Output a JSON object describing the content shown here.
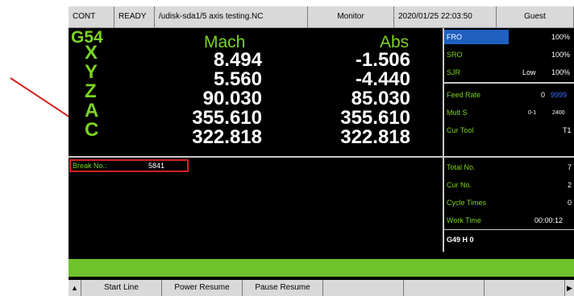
{
  "topbar": {
    "mode": "CONT",
    "state": "READY",
    "file": "/udisk-sda1/5 axis testing.NC",
    "view": "Monitor",
    "datetime": "2020/01/25 22:03:50",
    "user": "Guest"
  },
  "coords": {
    "wcs": "G54",
    "mach_title": "Mach",
    "abs_title": "Abs",
    "axes": [
      {
        "name": "X",
        "mach": "8.494",
        "abs": "-1.506"
      },
      {
        "name": "Y",
        "mach": "5.560",
        "abs": "-4.440"
      },
      {
        "name": "Z",
        "mach": "90.030",
        "abs": "85.030"
      },
      {
        "name": "A",
        "mach": "355.610",
        "abs": "355.610"
      },
      {
        "name": "C",
        "mach": "322.818",
        "abs": "322.818"
      }
    ]
  },
  "break": {
    "label": "Break No.:",
    "value": "5841"
  },
  "right_panel": {
    "fro": {
      "label": "FRO",
      "value": "100%"
    },
    "sro": {
      "label": "SRO",
      "value": "100%"
    },
    "sjr": {
      "label": "SJR",
      "level": "Low",
      "value": "100%"
    },
    "feed_rate": {
      "label": "Feed Rate",
      "value": "0",
      "value2": "9999"
    },
    "mult_s": {
      "label": "Mult S",
      "value": "0-1",
      "value2": "2400"
    },
    "cur_tool": {
      "label": "Cur Tool",
      "value": "T1"
    },
    "total_no": {
      "label": "Total No.",
      "value": "7"
    },
    "cur_no": {
      "label": "Cur No.",
      "value": "2"
    },
    "cycle_times": {
      "label": "Cycle Times",
      "value": "0"
    },
    "work_time": {
      "label": "Work Time",
      "value": "00:00:12"
    },
    "gcode": "G49 H 0"
  },
  "softkeys": {
    "up_arrow": "▲",
    "start_line": "Start Line",
    "power_resume": "Power Resume",
    "pause_resume": "Pause Resume",
    "right_arrow": "▶"
  },
  "colors": {
    "label_green": "#7cd322",
    "fro_blue": "#1e5fc0",
    "status_bar_green": "#6ec22c",
    "annotation_red": "#d62020"
  }
}
